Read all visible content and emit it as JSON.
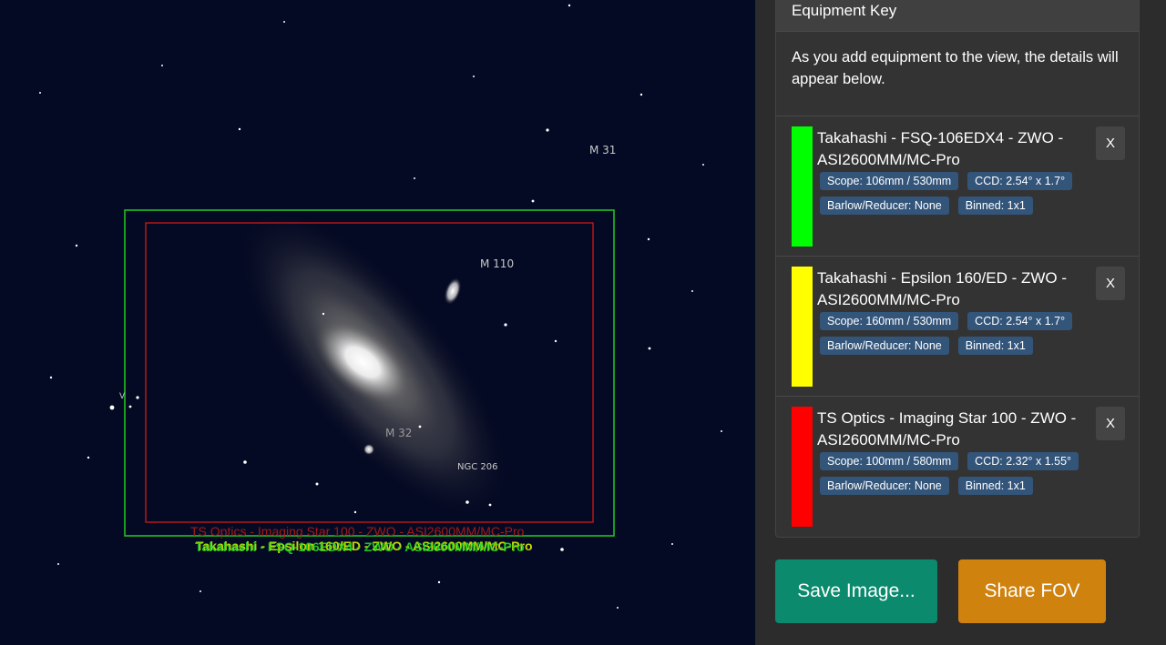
{
  "sky": {
    "labels": {
      "m31": "M 31",
      "m110": "M 110",
      "m32": "M 32",
      "ngc206": "NGC 206",
      "v": "V"
    },
    "fov_labels": {
      "red": "TS Optics - Imaging Star 100 - ZWO - ASI2600MM/MC-Pro",
      "yellow": "Takahashi - Epsilon 160/ED - ZWO - ASI2600MM/MC-Pro",
      "green": "Takahashi - FSQ-106EDX4 - ZWO - ASI2600MM/MC-Pro"
    },
    "colors": {
      "background": "#050a24",
      "green_frame": "#20c020",
      "red_frame": "#c01818"
    }
  },
  "equipment_key": {
    "title": "Equipment Key",
    "description": "As you add equipment to the view, the details will appear below.",
    "items": [
      {
        "color": "#00ff00",
        "title": "Takahashi - FSQ-106EDX4 - ZWO - ASI2600MM/MC-Pro",
        "scope": "Scope: 106mm / 530mm",
        "ccd": "CCD: 2.54° x 1.7°",
        "barlow": "Barlow/Reducer: None",
        "binned": "Binned: 1x1",
        "close": "X"
      },
      {
        "color": "#ffff00",
        "title": "Takahashi - Epsilon 160/ED - ZWO - ASI2600MM/MC-Pro",
        "scope": "Scope: 160mm / 530mm",
        "ccd": "CCD: 2.54° x 1.7°",
        "barlow": "Barlow/Reducer: None",
        "binned": "Binned: 1x1",
        "close": "X"
      },
      {
        "color": "#ff0000",
        "title": "TS Optics - Imaging Star 100 - ZWO - ASI2600MM/MC-Pro",
        "scope": "Scope: 100mm / 580mm",
        "ccd": "CCD: 2.32° x 1.55°",
        "barlow": "Barlow/Reducer: None",
        "binned": "Binned: 1x1",
        "close": "X"
      }
    ]
  },
  "actions": {
    "save_label": "Save Image...",
    "share_label": "Share FOV",
    "save_color": "#0b8a6e",
    "share_color": "#d0820e"
  }
}
